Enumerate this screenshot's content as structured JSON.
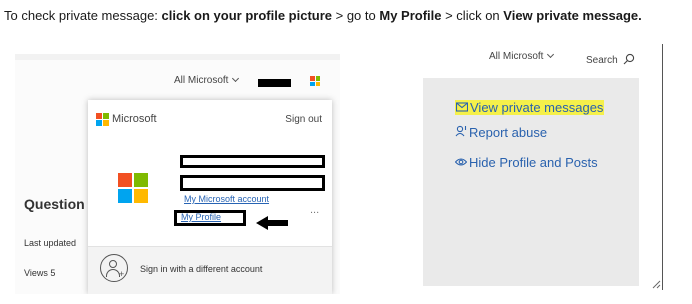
{
  "instruction": {
    "prefix": "To check private message: ",
    "step1": "click on your profile picture",
    "sep1": " > go to ",
    "step2": "My Profile",
    "sep2": " > click on ",
    "step3": "View private message."
  },
  "left_shot": {
    "header_nav": "All Microsoft",
    "brand": "Microsoft",
    "sign_out": "Sign out",
    "my_microsoft_account": "My Microsoft account",
    "my_profile": "My Profile",
    "more": "...",
    "footer_text": "Sign in with a different account",
    "question_heading": "Question",
    "last_updated": "Last updated",
    "views": "Views 5"
  },
  "right_shot": {
    "header_nav": "All Microsoft",
    "search": "Search",
    "actions": [
      {
        "label": "View private messages",
        "icon": "envelope-icon"
      },
      {
        "label": "Report abuse",
        "icon": "report-user-icon"
      },
      {
        "label": "Hide Profile and Posts",
        "icon": "eye-icon"
      }
    ]
  },
  "colors": {
    "link_blue": "#2a62ae",
    "highlight_yellow": "#f5f04a",
    "panel_gray": "#eaeaea"
  }
}
